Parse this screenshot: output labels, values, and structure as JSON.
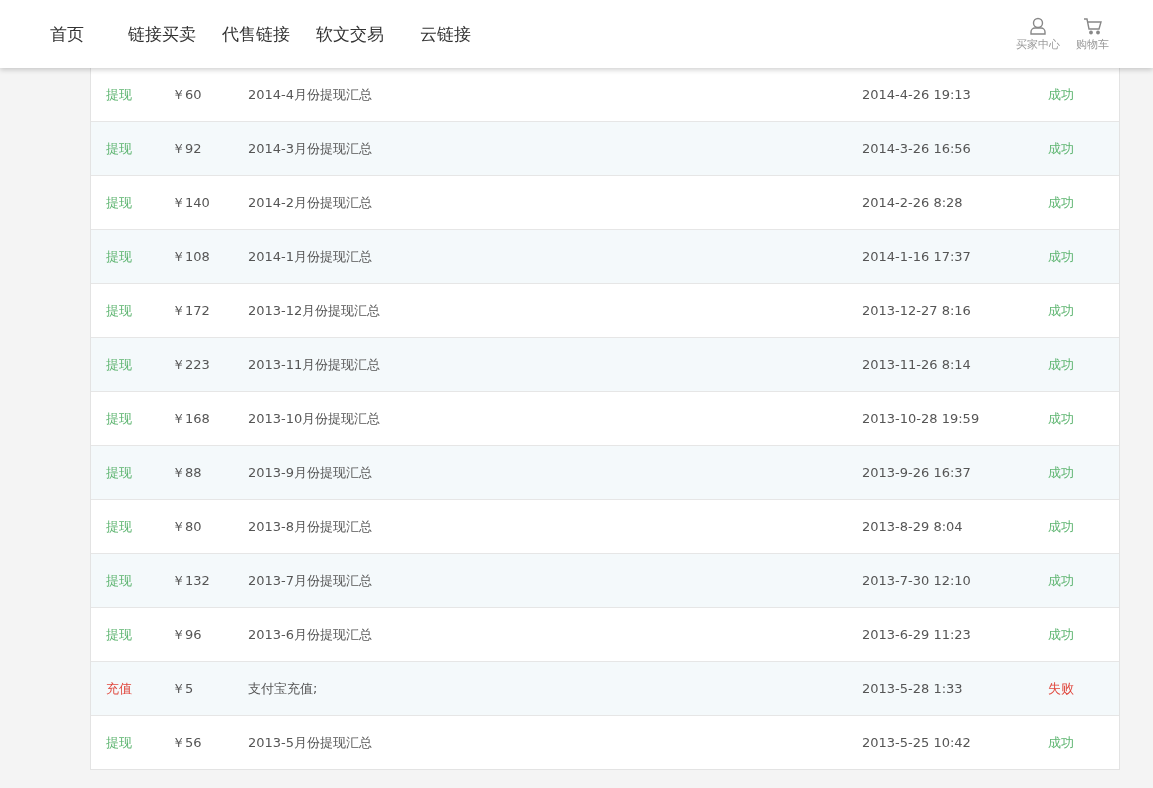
{
  "nav": {
    "items": [
      {
        "label": "首页",
        "selected": false
      },
      {
        "label": "链接买卖",
        "selected": false
      },
      {
        "label": "代售链接",
        "selected": false
      },
      {
        "label": "软文交易",
        "selected": false
      },
      {
        "label": "云链接",
        "selected": false
      }
    ],
    "user_links": [
      {
        "kind": "user",
        "label": "买家中心"
      },
      {
        "kind": "cart",
        "label": "购物车"
      }
    ]
  },
  "rows": [
    {
      "type": "提现",
      "amount": "￥60",
      "description": "2014-4月份提现汇总",
      "time": "2014-4-26 19:13",
      "status": "成功",
      "color": "#5cb46f"
    },
    {
      "type": "提现",
      "amount": "￥92",
      "description": "2014-3月份提现汇总",
      "time": "2014-3-26 16:56",
      "status": "成功",
      "color": "#5cb46f"
    },
    {
      "type": "提现",
      "amount": "￥140",
      "description": "2014-2月份提现汇总",
      "time": "2014-2-26 8:28",
      "status": "成功",
      "color": "#5cb46f"
    },
    {
      "type": "提现",
      "amount": "￥108",
      "description": "2014-1月份提现汇总",
      "time": "2014-1-16 17:37",
      "status": "成功",
      "color": "#5cb46f"
    },
    {
      "type": "提现",
      "amount": "￥172",
      "description": "2013-12月份提现汇总",
      "time": "2013-12-27 8:16",
      "status": "成功",
      "color": "#5cb46f"
    },
    {
      "type": "提现",
      "amount": "￥223",
      "description": "2013-11月份提现汇总",
      "time": "2013-11-26 8:14",
      "status": "成功",
      "color": "#5cb46f"
    },
    {
      "type": "提现",
      "amount": "￥168",
      "description": "2013-10月份提现汇总",
      "time": "2013-10-28 19:59",
      "status": "成功",
      "color": "#5cb46f"
    },
    {
      "type": "提现",
      "amount": "￥88",
      "description": "2013-9月份提现汇总",
      "time": "2013-9-26 16:37",
      "status": "成功",
      "color": "#5cb46f"
    },
    {
      "type": "提现",
      "amount": "￥80",
      "description": "2013-8月份提现汇总",
      "time": "2013-8-29 8:04",
      "status": "成功",
      "color": "#5cb46f"
    },
    {
      "type": "提现",
      "amount": "￥132",
      "description": "2013-7月份提现汇总",
      "time": "2013-7-30 12:10",
      "status": "成功",
      "color": "#5cb46f"
    },
    {
      "type": "提现",
      "amount": "￥96",
      "description": "2013-6月份提现汇总",
      "time": "2013-6-29 11:23",
      "status": "成功",
      "color": "#5cb46f"
    },
    {
      "type": "充值",
      "amount": "￥5",
      "description": "支付宝充值;",
      "time": "2013-5-28 1:33",
      "status": "失败",
      "color": "#e0483e"
    },
    {
      "type": "提现",
      "amount": "￥56",
      "description": "2013-5月份提现汇总",
      "time": "2013-5-25 10:42",
      "status": "成功",
      "color": "#5cb46f"
    }
  ]
}
